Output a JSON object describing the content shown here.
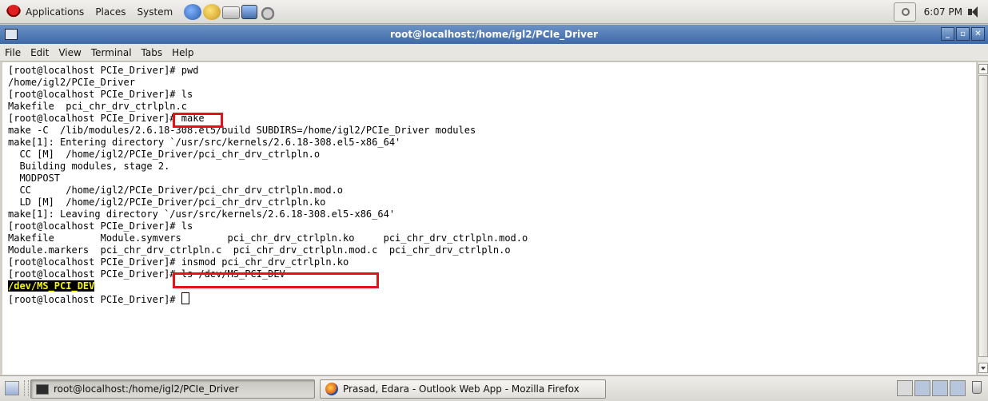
{
  "top_panel": {
    "menus": [
      "Applications",
      "Places",
      "System"
    ],
    "clock": "6:07 PM"
  },
  "window": {
    "title": "root@localhost:/home/igl2/PCIe_Driver",
    "buttons": [
      "_",
      "▫",
      "✕"
    ]
  },
  "menubar": [
    "File",
    "Edit",
    "View",
    "Terminal",
    "Tabs",
    "Help"
  ],
  "terminal": {
    "lines": [
      "[root@localhost PCIe_Driver]# pwd",
      "/home/igl2/PCIe_Driver",
      "[root@localhost PCIe_Driver]# ls",
      "Makefile  pci_chr_drv_ctrlpln.c",
      "[root@localhost PCIe_Driver]# make",
      "make -C  /lib/modules/2.6.18-308.el5/build SUBDIRS=/home/igl2/PCIe_Driver modules",
      "make[1]: Entering directory `/usr/src/kernels/2.6.18-308.el5-x86_64'",
      "  CC [M]  /home/igl2/PCIe_Driver/pci_chr_drv_ctrlpln.o",
      "  Building modules, stage 2.",
      "  MODPOST",
      "  CC      /home/igl2/PCIe_Driver/pci_chr_drv_ctrlpln.mod.o",
      "  LD [M]  /home/igl2/PCIe_Driver/pci_chr_drv_ctrlpln.ko",
      "make[1]: Leaving directory `/usr/src/kernels/2.6.18-308.el5-x86_64'",
      "[root@localhost PCIe_Driver]# ls",
      "Makefile        Module.symvers        pci_chr_drv_ctrlpln.ko     pci_chr_drv_ctrlpln.mod.o",
      "Module.markers  pci_chr_drv_ctrlpln.c  pci_chr_drv_ctrlpln.mod.c  pci_chr_drv_ctrlpln.o",
      "[root@localhost PCIe_Driver]# insmod pci_chr_drv_ctrlpln.ko",
      "[root@localhost PCIe_Driver]# ls /dev/MS_PCI_DEV",
      "/dev/MS_PCI_DEV",
      "[root@localhost PCIe_Driver]# "
    ]
  },
  "taskbar": {
    "tasks": [
      "root@localhost:/home/igl2/PCIe_Driver",
      "Prasad, Edara - Outlook Web App - Mozilla Firefox"
    ]
  },
  "colors": {
    "highlight_box": "#e1141b",
    "output_highlight_fg": "#f6f600",
    "output_highlight_bg": "#000000",
    "titlebar": "#3e69a8"
  }
}
